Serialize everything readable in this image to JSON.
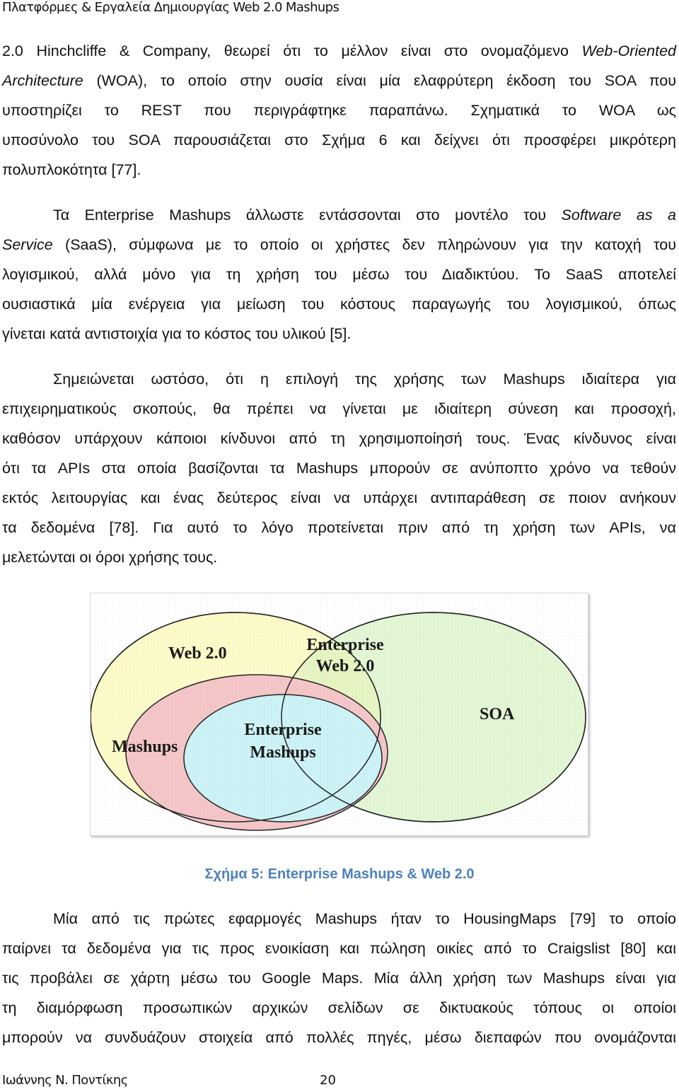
{
  "header": {
    "title": "Πλατφόρμες & Εργαλεία Δημιουργίας Web 2.0 Mashups"
  },
  "paragraphs": [
    {
      "lines": [
        [
          "2.0 Hinchcliffe & Company, θεωρεί ότι το μέλλον είναι στο ονομαζόμενο ",
          "Web-Oriented",
          ""
        ],
        [
          "",
          "Architecture",
          " (WOA), το οποίο στην ουσία είναι μία ελαφρύτερη έκδοση του SOA που"
        ],
        [
          "υποστηρίζει το REST που περιγράφτηκε παραπάνω. Σχηματικά το WOA ως",
          "",
          ""
        ],
        [
          "υποσύνολο του SOA παρουσιάζεται στο Σχήμα 6 και δείχνει ότι προσφέρει μικρότερη",
          "",
          ""
        ],
        [
          "πολυπλοκότητα [77].",
          "",
          ""
        ]
      ]
    },
    {
      "lines": [
        [
          "Τα Enterprise Mashups άλλωστε εντάσσονται στο μοντέλο του ",
          "Software as a",
          ""
        ],
        [
          "",
          "Service",
          " (SaaS), σύμφωνα με το οποίο οι χρήστες δεν πληρώνουν για την κατοχή του"
        ],
        [
          "λογισμικού, αλλά μόνο για τη χρήση του μέσω του Διαδικτύου. Το SaaS αποτελεί",
          "",
          ""
        ],
        [
          "ουσιαστικά μία ενέργεια για μείωση του κόστους παραγωγής του λογισμικού, όπως",
          "",
          ""
        ],
        [
          "γίνεται κατά αντιστοιχία για το κόστος του υλικού [5].",
          "",
          ""
        ]
      ]
    },
    {
      "lines": [
        [
          "Σημειώνεται ωστόσο, ότι η επιλογή της χρήσης των Mashups ιδιαίτερα για",
          "",
          ""
        ],
        [
          "επιχειρηματικούς σκοπούς, θα πρέπει να γίνεται με ιδιαίτερη σύνεση και προσοχή,",
          "",
          ""
        ],
        [
          "καθόσον υπάρχουν κάποιοι κίνδυνοι από τη χρησιμοποίησή τους. Ένας κίνδυνος είναι",
          "",
          ""
        ],
        [
          "ότι τα APIs στα οποία βασίζονται τα Mashups μπορούν σε ανύποπτο χρόνο να τεθούν",
          "",
          ""
        ],
        [
          "εκτός λειτουργίας και ένας δεύτερος είναι να υπάρχει αντιπαράθεση σε ποιον ανήκουν",
          "",
          ""
        ],
        [
          "τα δεδομένα [78]. Για αυτό το λόγο προτείνεται πριν από τη χρήση των APIs, να",
          "",
          ""
        ],
        [
          "μελετώνται οι όροι χρήσης τους.",
          "",
          ""
        ]
      ]
    },
    {
      "lines": [
        [
          "Μία από τις πρώτες εφαρμογές Mashups ήταν το HousingMaps [79] το οποίο",
          "",
          ""
        ],
        [
          "παίρνει τα δεδομένα για τις προς ενοικίαση και πώληση οικίες από το Craigslist [80] και",
          "",
          ""
        ],
        [
          "τις προβάλει σε χάρτη μέσω του Google Maps. Μία άλλη χρήση των Mashups είναι για",
          "",
          ""
        ],
        [
          "τη διαμόρφωση προσωπικών αρχικών σελίδων σε δικτυακούς τόπους οι οποίοι",
          "",
          ""
        ],
        [
          "μπορούν να συνδυάζουν στοιχεία από πολλές πηγές, μέσω διεπαφών που ονομάζονται",
          "",
          ""
        ]
      ]
    }
  ],
  "figure": {
    "caption": "Σχήμα 5: Enterprise Mashups & Web 2.0",
    "caption_color": "#4f81bd",
    "sets": [
      {
        "name": "Web 2.0",
        "color": "#fdfbc8"
      },
      {
        "name": "SOA",
        "color": "#e3f7d6"
      },
      {
        "name": "Enterprise Web 2.0",
        "color": "#e6f5c2"
      },
      {
        "name": "Mashups",
        "color": "#f5c6c8"
      },
      {
        "name": "Enterprise Mashups",
        "color": "#cdf3f7"
      }
    ],
    "labels": {
      "web20": "Web 2.0",
      "enterprise_web20_line1": "Enterprise",
      "enterprise_web20_line2": "Web 2.0",
      "soa": "SOA",
      "mashups": "Mashups",
      "enterprise_mashups_line1": "Enterprise",
      "enterprise_mashups_line2": "Mashups"
    }
  },
  "footer": {
    "author": "Ιωάννης Ν. Ποντίκης",
    "page_number": "20"
  }
}
